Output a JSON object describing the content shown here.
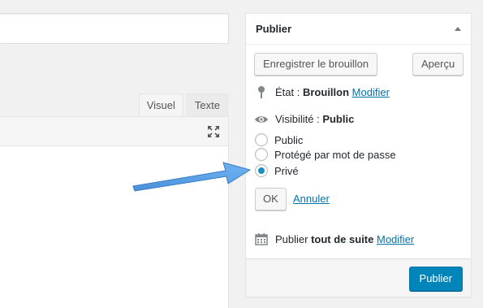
{
  "editor": {
    "tabs": [
      {
        "label": "Visuel"
      },
      {
        "label": "Texte"
      }
    ]
  },
  "publish_box": {
    "title": "Publier",
    "save_draft_label": "Enregistrer le brouillon",
    "preview_label": "Aperçu",
    "status": {
      "label": "État :",
      "value": "Brouillon",
      "edit_link": "Modifier"
    },
    "visibility": {
      "label": "Visibilité :",
      "value": "Public",
      "options": [
        {
          "label": "Public",
          "checked": false
        },
        {
          "label": "Protégé par mot de passe",
          "checked": false
        },
        {
          "label": "Privé",
          "checked": true
        }
      ],
      "ok_label": "OK",
      "cancel_label": "Annuler"
    },
    "schedule": {
      "label": "Publier",
      "value": "tout de suite",
      "edit_link": "Modifier"
    },
    "publish_button_label": "Publier"
  },
  "colors": {
    "accent": "#0085ba",
    "link": "#0073aa",
    "annotation_arrow": "#5aa5e8"
  }
}
